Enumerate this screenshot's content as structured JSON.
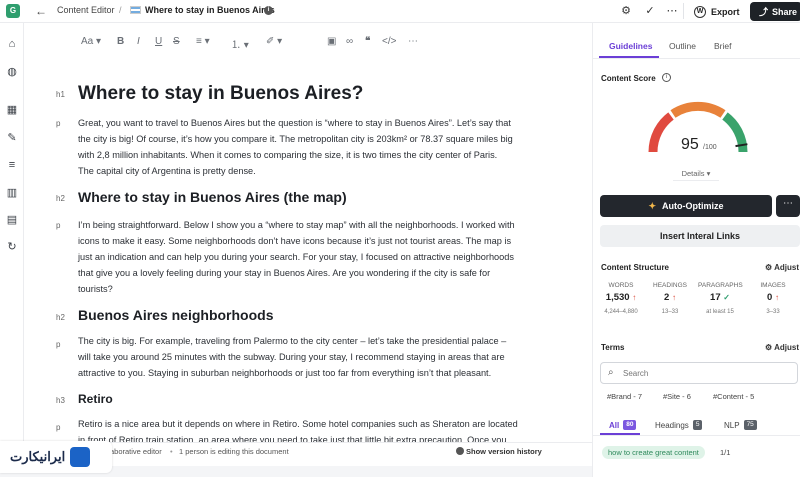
{
  "topbar": {
    "logo": "G",
    "breadcrumb": "Content Editor",
    "separator": "/",
    "doc_title": "Where to stay in Buenos Aires",
    "export_label": "Export",
    "share_label": "Share"
  },
  "editor": {
    "toolbar": {
      "text_style": "Aa"
    },
    "blocks": [
      {
        "tag": "h1",
        "text": "Where to stay in Buenos Aires?"
      },
      {
        "tag": "p",
        "lines": [
          "Great, you want to travel to Buenos Aires but the question is “where to stay in Buenos Aires”. Let’s say that",
          "the city is big! Of course, it’s how you compare it. The metropolitan city is 203km² or 78.37 square miles big",
          "with 2,8 million inhabitants. When it comes to comparing the size, it is two times the city center of Paris.",
          "The capital city of Argentina is pretty dense."
        ]
      },
      {
        "tag": "h2",
        "text": "Where to stay in Buenos Aires (the map)"
      },
      {
        "tag": "p",
        "lines": [
          "I’m being straightforward. Below I show you a “where to stay map” with all the neighborhoods. I worked with",
          "icons to make it easy. Some neighborhoods don’t have icons because it’s just not tourist areas. The map is",
          "just an indication and can help you during your search. For your stay, I focused on attractive neighborhoods",
          "that give you a lovely feeling during your stay in Buenos Aires. Are you wondering if the city is safe for",
          "tourists?"
        ]
      },
      {
        "tag": "h2",
        "text": "Buenos Aires neighborhoods"
      },
      {
        "tag": "p",
        "lines": [
          "The city is big. For example, traveling from Palermo to the city center – let’s take the presidential palace –",
          "will take you around 25 minutes with the subway. During your stay, I recommend staying in areas that are",
          "attractive to you. Staying in suburban neighborhoods or just too far from everything isn’t that pleasant."
        ]
      },
      {
        "tag": "h3",
        "text": "Retiro"
      },
      {
        "tag": "p",
        "lines": [
          "Retiro is a nice area but it depends on where in Retiro. Some hotel companies such as Sheraton are located",
          "in front of Retiro train station, an area where you need to take just that little bit extra precaution. Once you"
        ]
      }
    ],
    "footer": {
      "collab": "aborative editor",
      "dot": "•",
      "editing": "1 person is editing this document",
      "history": "Show version history"
    }
  },
  "watermark": {
    "text": "ایرانیکارت"
  },
  "panel": {
    "tabs": [
      "Guidelines",
      "Outline",
      "Brief"
    ],
    "content_score_label": "Content Score",
    "score": "95",
    "score_max": "/100",
    "score_value": 95,
    "details_label": "Details",
    "auto_optimize_label": "Auto-Optimize",
    "more_label": "⋯",
    "insert_links_label": "Insert Interal Links",
    "structure_title": "Content Structure",
    "adjust_label": "Adjust",
    "stats": [
      {
        "label": "WORDS",
        "value": "1,530",
        "trend": "↑",
        "range": "4,244–4,880"
      },
      {
        "label": "HEADINGS",
        "value": "2",
        "trend": "↑",
        "range": "13–33"
      },
      {
        "label": "PARAGRAPHS",
        "value": "17",
        "trend": "✓",
        "range": "at least 15"
      },
      {
        "label": "IMAGES",
        "value": "0",
        "trend": "↑",
        "range": "3–33"
      }
    ],
    "terms_title": "Terms",
    "search_placeholder": "Search",
    "chips": [
      "#Brand - 7",
      "#Site - 6",
      "#Content - 5"
    ],
    "filter_tabs": [
      {
        "label": "All",
        "count": "80"
      },
      {
        "label": "Headings",
        "count": "5"
      },
      {
        "label": "NLP",
        "count": "75"
      }
    ],
    "term": {
      "text": "how to create great content",
      "count": "1/1"
    }
  },
  "colors": {
    "accent": "#6b3fd6",
    "dark_button": "#23272d",
    "gauge_red": "#e04a3f",
    "gauge_orange": "#e8823a",
    "gauge_green": "#3aa36b"
  }
}
